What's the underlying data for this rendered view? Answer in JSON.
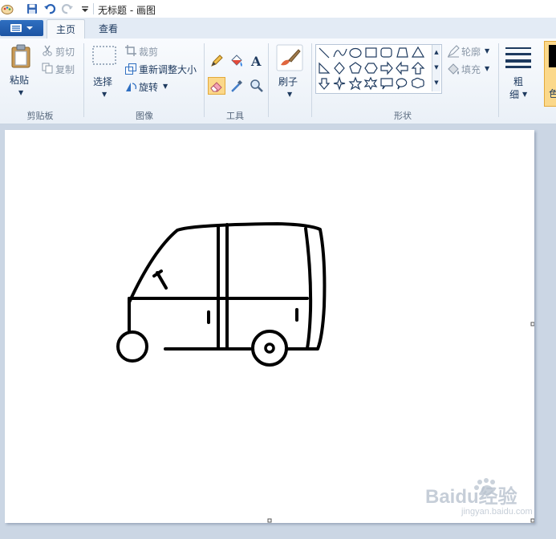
{
  "window": {
    "title": "无标题 - 画图"
  },
  "tabs": [
    {
      "label": "主页",
      "active": true
    },
    {
      "label": "查看",
      "active": false
    }
  ],
  "clipboard": {
    "paste_label": "粘贴",
    "cut_label": "剪切",
    "copy_label": "复制",
    "group_label": "剪贴板"
  },
  "image": {
    "select_label": "选择",
    "crop_label": "裁剪",
    "resize_label": "重新调整大小",
    "rotate_label": "旋转",
    "group_label": "图像"
  },
  "tools": {
    "group_label": "工具",
    "selected": "eraser"
  },
  "brushes": {
    "label": "刷子"
  },
  "shapes": {
    "outline_label": "轮廓",
    "fill_label": "填充",
    "group_label": "形状"
  },
  "size": {
    "label_line1": "粗",
    "label_line2": "细"
  },
  "color": {
    "label_partial": "颜\n色"
  },
  "watermark": {
    "text": "Baidu经验",
    "url": "jingyan.baidu.com"
  },
  "colors": {
    "accent": "#2f6fc1",
    "selected_tool": "#fbd88a",
    "canvas": "#ffffff",
    "workspace": "#cbd6e4"
  }
}
